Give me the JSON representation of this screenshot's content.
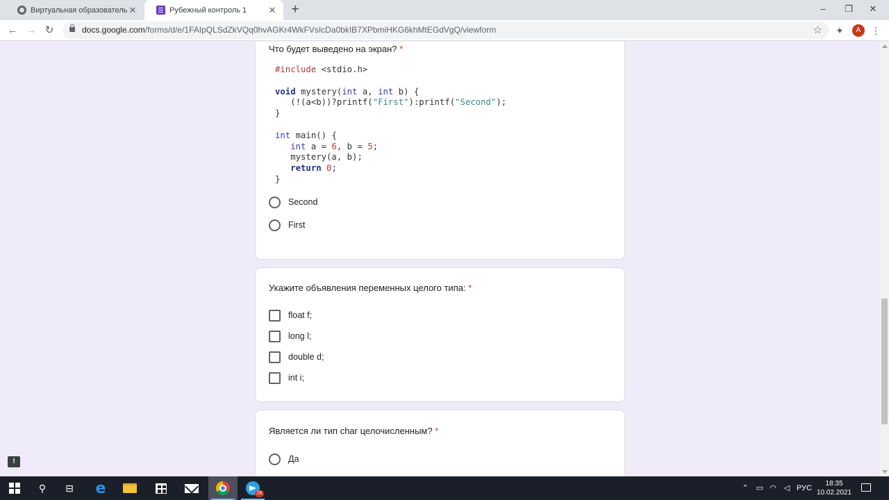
{
  "browser": {
    "tabs": [
      {
        "title": "Виртуальная образовательная с",
        "favicon": "globe-icon"
      },
      {
        "title": "Рубежный контроль 1",
        "favicon": "google-forms-icon"
      }
    ],
    "new_tab_label": "+",
    "window_controls": {
      "minimize": "–",
      "maximize": "❐",
      "close": "✕"
    },
    "url_host": "docs.google.com",
    "url_path": "/forms/d/e/1FAIpQLSdZkVQq0hvAGKr4WkFVsIcDa0bkIB7XPbmiHKG6khMtEGdVgQ/viewform",
    "profile_initial": "A"
  },
  "form": {
    "required_mark": "*",
    "questions": [
      {
        "title": "Что будет выведено на экран?",
        "type": "radio",
        "code": [
          {
            "tokens": [
              {
                "t": "#include",
                "c": "pp"
              },
              {
                "t": " <stdio.h>",
                "c": ""
              }
            ]
          },
          {
            "tokens": []
          },
          {
            "tokens": [
              {
                "t": "void",
                "c": "kw"
              },
              {
                "t": " mystery(",
                "c": ""
              },
              {
                "t": "int",
                "c": "ty"
              },
              {
                "t": " a, ",
                "c": ""
              },
              {
                "t": "int",
                "c": "ty"
              },
              {
                "t": " b) {",
                "c": ""
              }
            ]
          },
          {
            "tokens": [
              {
                "t": "   (!(a<b))?printf(",
                "c": ""
              },
              {
                "t": "\"First\"",
                "c": "str"
              },
              {
                "t": "):printf(",
                "c": ""
              },
              {
                "t": "\"Second\"",
                "c": "str"
              },
              {
                "t": ");",
                "c": ""
              }
            ]
          },
          {
            "tokens": [
              {
                "t": "}",
                "c": ""
              }
            ]
          },
          {
            "tokens": []
          },
          {
            "tokens": [
              {
                "t": "int",
                "c": "ty"
              },
              {
                "t": " main() {",
                "c": ""
              }
            ]
          },
          {
            "tokens": [
              {
                "t": "   ",
                "c": ""
              },
              {
                "t": "int",
                "c": "ty"
              },
              {
                "t": " a = ",
                "c": ""
              },
              {
                "t": "6",
                "c": "num"
              },
              {
                "t": ", b = ",
                "c": ""
              },
              {
                "t": "5",
                "c": "num"
              },
              {
                "t": ";",
                "c": ""
              }
            ]
          },
          {
            "tokens": [
              {
                "t": "   mystery(a, b);",
                "c": ""
              }
            ]
          },
          {
            "tokens": [
              {
                "t": "   ",
                "c": ""
              },
              {
                "t": "return",
                "c": "kw"
              },
              {
                "t": " ",
                "c": ""
              },
              {
                "t": "0",
                "c": "num"
              },
              {
                "t": ";",
                "c": ""
              }
            ]
          },
          {
            "tokens": [
              {
                "t": "}",
                "c": ""
              }
            ]
          }
        ],
        "options": [
          "Second",
          "First"
        ]
      },
      {
        "title": "Укажите объявления переменных целого типа:",
        "type": "checkbox",
        "options": [
          "float f;",
          "long l;",
          "double d;",
          "int i;"
        ]
      },
      {
        "title": "Является ли тип char целочисленным?",
        "type": "radio",
        "options": [
          "Да"
        ]
      }
    ]
  },
  "taskbar": {
    "apps": [
      "windows-start-icon",
      "search-icon",
      "task-view-icon",
      "edge-icon",
      "file-explorer-icon",
      "store-icon",
      "mail-icon",
      "chrome-icon",
      "telegram-icon"
    ],
    "telegram_badge": "29",
    "language": "РУС",
    "time": "18:35",
    "date": "10.02.2021"
  },
  "colors": {
    "page_bg": "#f0ebf8",
    "required": "#d93025",
    "forms_accent": "#673ab7"
  }
}
